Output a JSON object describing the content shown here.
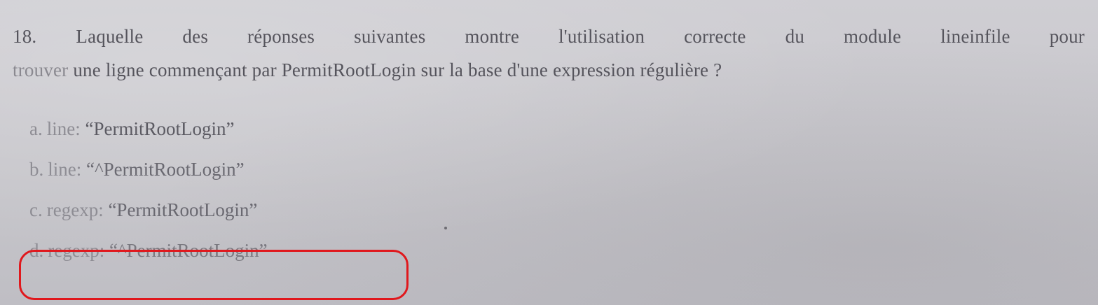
{
  "question": {
    "number": "18.",
    "line1": "Laquelle des réponses suivantes montre l'utilisation correcte du module lineinfile pour",
    "line2_start": "trouver",
    "line2_rest": " une ligne commençant par PermitRootLogin sur la base d'une expression régulière ?"
  },
  "options": [
    {
      "letter": "a.",
      "key": "line:",
      "value": "“PermitRootLogin”"
    },
    {
      "letter": "b.",
      "key": "line:",
      "value": "“^PermitRootLogin”"
    },
    {
      "letter": "c.",
      "key": "regexp:",
      "value": "“PermitRootLogin”"
    },
    {
      "letter": "d.",
      "key": "regexp:",
      "value": "“^PermitRootLogin”"
    }
  ],
  "highlight": {
    "selected_option": "d",
    "color": "#e0181d"
  }
}
